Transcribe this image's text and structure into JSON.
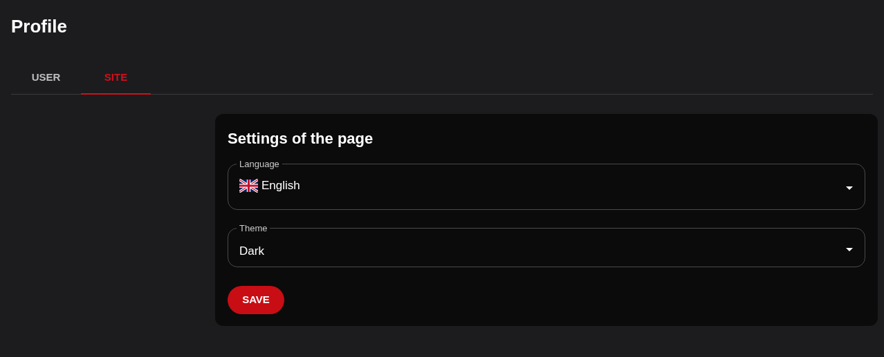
{
  "page": {
    "title": "Profile"
  },
  "tabs": [
    {
      "label": "USER",
      "selected": false
    },
    {
      "label": "SITE",
      "selected": true
    }
  ],
  "card": {
    "title": "Settings of the page",
    "fields": [
      {
        "kind": "flag",
        "label": "Language",
        "value": "English"
      },
      {
        "kind": "plain",
        "label": "Theme",
        "value": "Dark"
      }
    ],
    "button": "SAVE"
  }
}
